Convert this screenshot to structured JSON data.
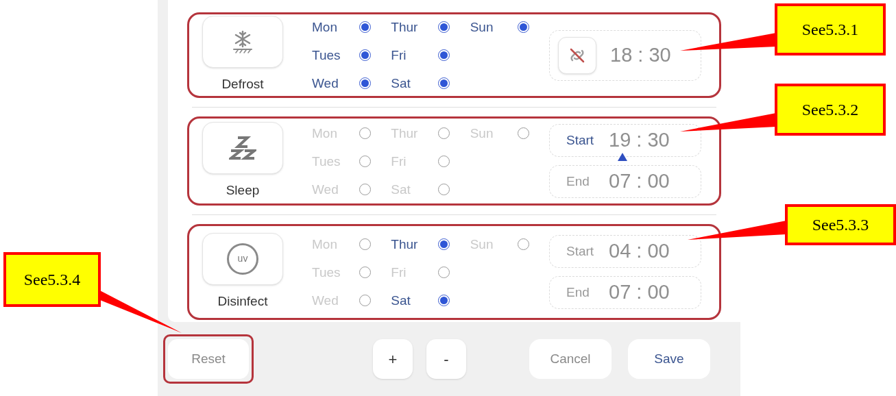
{
  "schedules": [
    {
      "name": "Defrost",
      "kind": "defrost",
      "highlighted": true,
      "days": [
        {
          "label": "Mon",
          "checked": true
        },
        {
          "label": "Tues",
          "checked": true
        },
        {
          "label": "Wed",
          "checked": true
        },
        {
          "label": "Thur",
          "checked": true
        },
        {
          "label": "Fri",
          "checked": true
        },
        {
          "label": "Sat",
          "checked": true
        },
        {
          "label": "Sun",
          "checked": true
        }
      ],
      "times": [
        {
          "kind": "toggle",
          "value": "18 : 30"
        }
      ]
    },
    {
      "name": "Sleep",
      "kind": "sleep",
      "highlighted": true,
      "days": [
        {
          "label": "Mon",
          "checked": false
        },
        {
          "label": "Tues",
          "checked": false
        },
        {
          "label": "Wed",
          "checked": false
        },
        {
          "label": "Thur",
          "checked": false
        },
        {
          "label": "Fri",
          "checked": false
        },
        {
          "label": "Sat",
          "checked": false
        },
        {
          "label": "Sun",
          "checked": false
        }
      ],
      "times": [
        {
          "kind": "labeled",
          "label": "Start",
          "value": "19 : 30",
          "selected": true
        },
        {
          "kind": "labeled",
          "label": "End",
          "value": "07 : 00",
          "selected": false
        }
      ]
    },
    {
      "name": "Disinfect",
      "kind": "uv",
      "icon_text": "uv",
      "highlighted": true,
      "days": [
        {
          "label": "Mon",
          "checked": false
        },
        {
          "label": "Tues",
          "checked": false
        },
        {
          "label": "Wed",
          "checked": false
        },
        {
          "label": "Thur",
          "checked": true
        },
        {
          "label": "Fri",
          "checked": false
        },
        {
          "label": "Sat",
          "checked": true
        },
        {
          "label": "Sun",
          "checked": false
        }
      ],
      "times": [
        {
          "kind": "labeled",
          "label": "Start",
          "value": "04 : 00",
          "selected": false
        },
        {
          "kind": "labeled",
          "label": "End",
          "value": "07 : 00",
          "selected": false
        }
      ]
    }
  ],
  "footer": {
    "reset": {
      "label": "Reset",
      "highlighted": true
    },
    "steppers": [
      "+",
      "-"
    ],
    "cancel": "Cancel",
    "save": "Save"
  },
  "callouts": [
    {
      "text": "See5.3.1"
    },
    {
      "text": "See5.3.2"
    },
    {
      "text": "See5.3.3"
    },
    {
      "text": "See5.3.4"
    }
  ]
}
